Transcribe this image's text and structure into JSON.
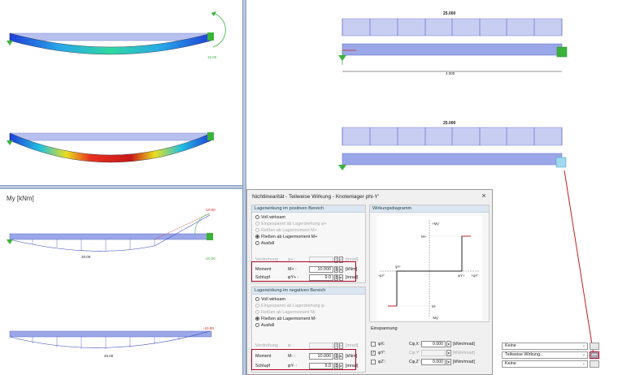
{
  "views": {
    "top_right": {
      "load_label_1": "25.000",
      "span_label": "4.000",
      "load_label_2": "25.000"
    },
    "top_left": {
      "rotation_value": "10.00"
    },
    "bottom_left": {
      "title": "My [kNm]",
      "beam1_mid_value": "20.00",
      "beam1_right_top": "-10.00",
      "beam1_right_bottom": "-10.00",
      "beam2_mid_value": "45.00",
      "beam2_right_value": "-10.00"
    }
  },
  "dialog": {
    "title": "Nichtlinearität - Teilweise Wirkung - Knotenlager phi-Y'",
    "close_label": "×",
    "positive": {
      "header": "Lagerwirkung im positiven Bereich",
      "options": [
        {
          "label": "Voll wirksam",
          "selected": false,
          "enabled": true
        },
        {
          "label": "Eingespannt ab Lagerdrehung φ+",
          "selected": false,
          "enabled": false
        },
        {
          "label": "Reißen ab Lagermoment M+",
          "selected": false,
          "enabled": false
        },
        {
          "label": "Fließen ab Lagermoment M+",
          "selected": true,
          "enabled": true
        },
        {
          "label": "Ausfall",
          "selected": false,
          "enabled": true
        }
      ],
      "verdrehung": {
        "label": "Verdrehung",
        "symbol": "φ+ :",
        "value": "",
        "unit": "[mrad]"
      },
      "moment": {
        "label": "Moment",
        "symbol": "M+ :",
        "value": "10.000",
        "unit": "[kNm]"
      },
      "schlupf": {
        "label": "Schlupf",
        "symbol": "φY+ :",
        "value": "9.0",
        "unit": "[mrad]"
      }
    },
    "negative": {
      "header": "Lagerwirkung im negativen Bereich",
      "options": [
        {
          "label": "Voll wirksam",
          "selected": false,
          "enabled": true
        },
        {
          "label": "Eingespannt ab Lagerdrehung φ-",
          "selected": false,
          "enabled": false
        },
        {
          "label": "Reißen ab Lagermoment M-",
          "selected": false,
          "enabled": false
        },
        {
          "label": "Fließen ab Lagermoment M-",
          "selected": true,
          "enabled": true
        },
        {
          "label": "Ausfall",
          "selected": false,
          "enabled": true
        }
      ],
      "verdrehung": {
        "label": "Verdrehung",
        "symbol": "φ- :",
        "value": "",
        "unit": "[mrad]"
      },
      "moment": {
        "label": "Moment",
        "symbol": "M- :",
        "value": "10.000",
        "unit": "[kNm]"
      },
      "schlupf": {
        "label": "Schlupf",
        "symbol": "φY- :",
        "value": "9.0",
        "unit": "[mrad]"
      }
    },
    "diagram": {
      "header": "Wirkungsdiagramm",
      "axis_top": "+My'",
      "axis_bottom": "-My'",
      "axis_left": "-φY'",
      "axis_right": "+φY'",
      "m_plus": "M+",
      "m_minus": "M-",
      "phi_minus": "φY-",
      "phi_plus": "φY+"
    },
    "clamping": {
      "title": "Einspannung",
      "rows": [
        {
          "symbol": "φX:",
          "c_label": "Cφ,X :",
          "value": "0.000",
          "unit": "[kNm/mrad]",
          "checked": false,
          "enabled": true
        },
        {
          "symbol": "φY':",
          "c_label": "Cφ,Y' :",
          "value": "",
          "unit": "[kNm/mrad]",
          "checked": true,
          "enabled": false
        },
        {
          "symbol": "φZ':",
          "c_label": "Cφ,Z' :",
          "value": "0.000",
          "unit": "[kNm/mrad]",
          "checked": false,
          "enabled": true
        }
      ]
    }
  },
  "nonlinearity_combos": [
    {
      "value": "Keine"
    },
    {
      "value": "Teilweise Wirkung..."
    },
    {
      "value": "Keine"
    }
  ],
  "colors": {
    "beam_fill": "#9aa7e8",
    "load_fill": "#c8cdf2",
    "highlight_red": "#b00020",
    "support_green": "#3ab23a"
  }
}
